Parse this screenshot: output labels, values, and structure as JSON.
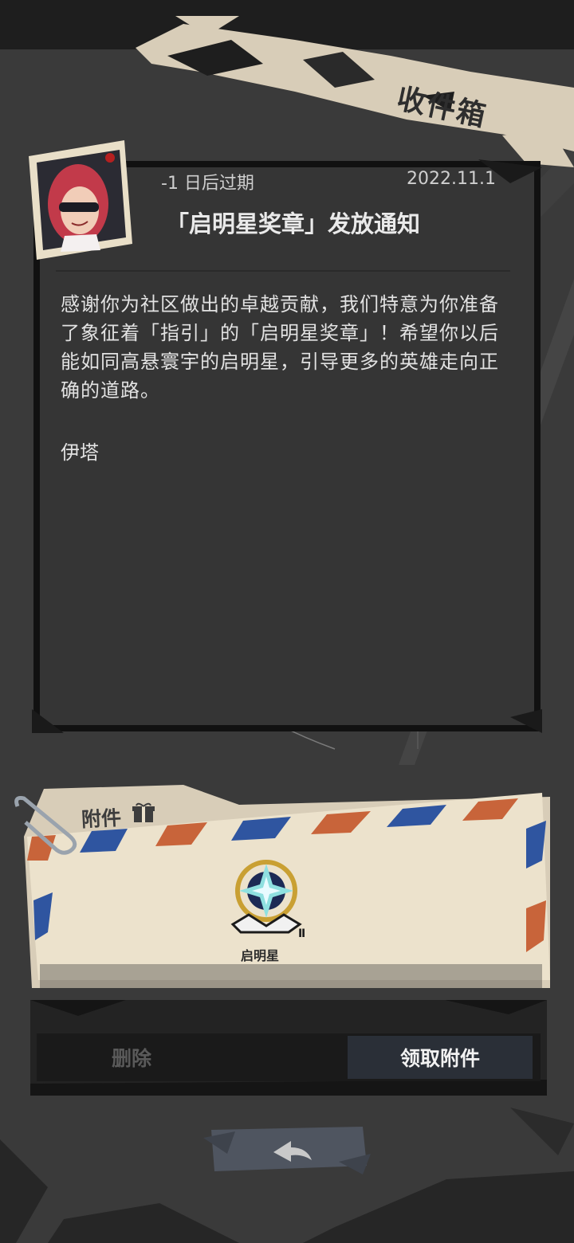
{
  "header": {
    "title": "收件箱"
  },
  "mail": {
    "expire_text": "-1 日后过期",
    "date": "2022.11.1",
    "title": "「启明星奖章」发放通知",
    "body": "感谢你为社区做出的卓越贡献，我们特意为你准备了象征着「指引」的「启明星奖章」！希望你以后能如同高悬寰宇的启明星，引导更多的英雄走向正确的道路。",
    "signature": "伊塔"
  },
  "attachments": {
    "label": "附件",
    "items": [
      {
        "name": "启明星",
        "icon": "star-medal-icon"
      }
    ]
  },
  "actions": {
    "delete_label": "删除",
    "claim_label": "领取附件"
  },
  "icons": {
    "back": "back-arrow-icon",
    "gift": "gift-icon",
    "paperclip": "paperclip-icon",
    "avatar": "avatar"
  },
  "colors": {
    "background": "#3a3a3a",
    "banner": "#d8cdb8",
    "envelope": "#ece2cc",
    "stripe_red": "#c8643a",
    "stripe_blue": "#2f55a0",
    "claim_button": "#2a2f37"
  }
}
